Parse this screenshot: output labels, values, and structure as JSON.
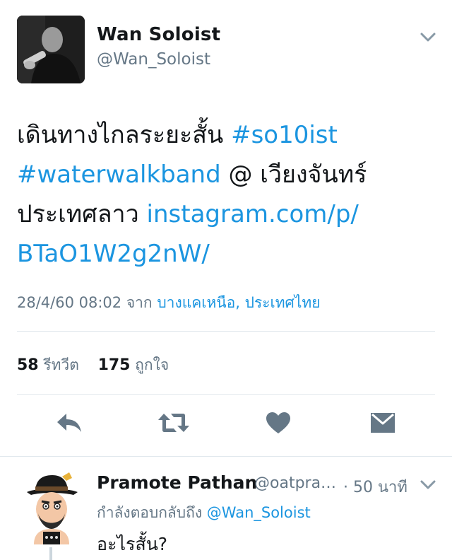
{
  "tweet": {
    "author_name": "Wan Soloist",
    "author_handle": "@Wan_Soloist",
    "text_part1": "เดินทางไกลระยะสั้น ",
    "hashtag1": "#so10ist",
    "hashtag2": "#waterwalkband",
    "text_part2": " @ เวียงจันทร์",
    "text_part3": "ประเทศลาว ",
    "link_line1": "instagram.com/p/",
    "link_line2": "BTaO1W2g2nW/",
    "timestamp": "28/4/60 08:02",
    "from_label": " จาก ",
    "location": "บางแคเหนือ, ประเทศไทย",
    "retweet_count": "58",
    "retweet_label": " รีทวีต",
    "like_count": "175",
    "like_label": " ถูกใจ"
  },
  "actions": {
    "reply_icon": "reply-icon",
    "retweet_icon": "retweet-icon",
    "like_icon": "heart-icon",
    "dm_icon": "envelope-icon"
  },
  "reply": {
    "author_name": "Pramote Pathan",
    "author_handle": "@oatpra…",
    "time": "· 50 นาที",
    "replying_prefix": "กำลังตอบกลับถึง ",
    "replying_to": "@Wan_Soloist",
    "text": "อะไรสั้น?"
  },
  "colors": {
    "link": "#1b95e0",
    "secondary_text": "#657786",
    "divider": "#e1e8ed",
    "icon": "#657786"
  }
}
